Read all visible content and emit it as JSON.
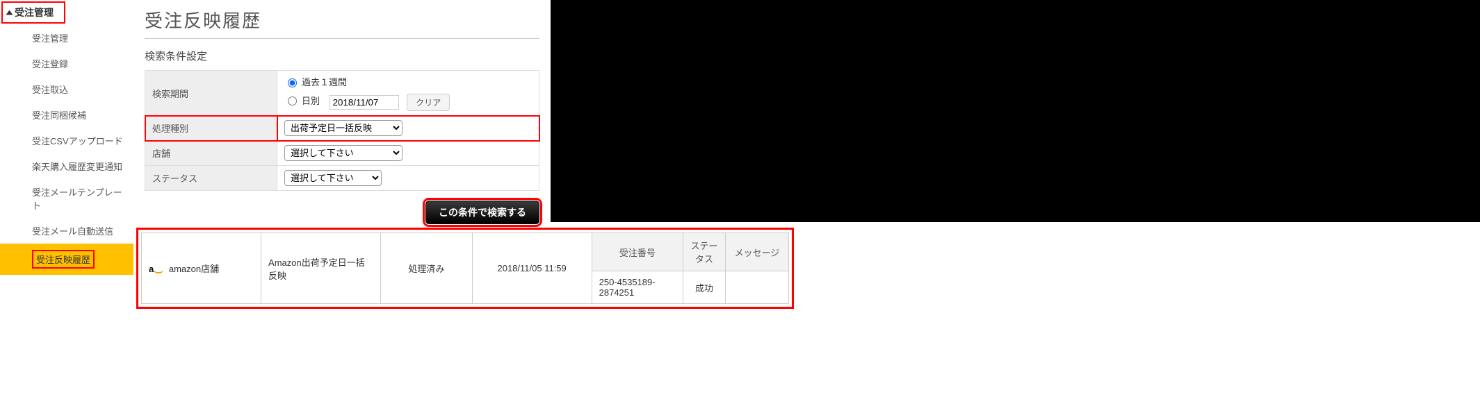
{
  "sidebar": {
    "head": "受注管理",
    "items": [
      {
        "label": "受注管理"
      },
      {
        "label": "受注登録"
      },
      {
        "label": "受注取込"
      },
      {
        "label": "受注同梱候補"
      },
      {
        "label": "受注CSVアップロード"
      },
      {
        "label": "楽天購入履歴変更通知"
      },
      {
        "label": "受注メールテンプレート"
      },
      {
        "label": "受注メール自動送信"
      },
      {
        "label": "受注反映履歴",
        "active": true
      }
    ]
  },
  "page_title": "受注反映履歴",
  "section_title": "検索条件設定",
  "form": {
    "period_label": "検索期間",
    "radio_week": "過去１週間",
    "radio_day": "日別",
    "date_value": "2018/11/07",
    "clear": "クリア",
    "type_label": "処理種別",
    "type_value": "出荷予定日一括反映",
    "shop_label": "店舗",
    "shop_value": "選択して下さい",
    "status_label": "ステータス",
    "status_value": "選択して下さい",
    "search": "この条件で検索する"
  },
  "results": {
    "head": {
      "order_no": "受注番号",
      "status": "ステータス",
      "message": "メッセージ"
    },
    "row": {
      "shop": "amazon店舗",
      "type": "Amazon出荷予定日一括反映",
      "state": "処理済み",
      "time": "2018/11/05 11:59",
      "order_no": "250-4535189-2874251",
      "status": "成功",
      "message": ""
    }
  }
}
